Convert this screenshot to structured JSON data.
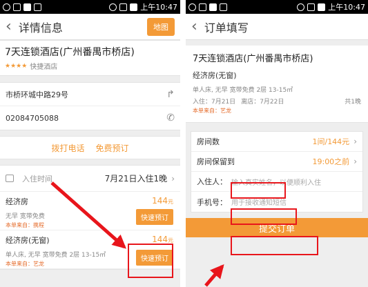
{
  "left": {
    "status": {
      "time": "上午10:47"
    },
    "nav": {
      "title": "详情信息",
      "map_label": "地图"
    },
    "hotel": {
      "name": "7天连锁酒店(广州番禺市桥店)",
      "category": "快捷酒店",
      "stars": "★★★★"
    },
    "address": "市桥环城中路29号",
    "phone": "02084705088",
    "actions": {
      "call": "拨打电话",
      "book_free": "免费预订"
    },
    "checkin": {
      "label": "入住时间",
      "value": "7月21日入住1晚"
    },
    "rooms": [
      {
        "name": "经济房",
        "price": "144",
        "unit": "元",
        "desc": "无早 宽带免费",
        "source": "本单来自：携程",
        "button": "快速预订"
      },
      {
        "name": "经济房(无窗)",
        "price": "144",
        "unit": "元",
        "desc": "单人床, 无早 宽带免费 2层 13-15㎡",
        "source": "本单来自：艺龙",
        "button": "快速预订"
      }
    ]
  },
  "right": {
    "status": {
      "time": "上午10:47"
    },
    "nav": {
      "title": "订单填写"
    },
    "order": {
      "hotel_name": "7天连锁酒店(广州番禺市桥店)",
      "room": "经济房(无窗)",
      "desc": "单人床, 无早 宽带免费 2层 13-15㎡",
      "checkin": "入住：7月21日",
      "checkout": "离店：7月22日",
      "nights": "共1晚",
      "source": "本单来自：艺龙"
    },
    "form": {
      "rooms_label": "房间数",
      "rooms_value": "1间/144元",
      "hold_label": "房间保留到",
      "hold_value": "19:00之前",
      "guest_label": "入住人：",
      "guest_placeholder": "输入真实姓名",
      "guest_hint": "，以便顺利入住",
      "mobile_label": "手机号：",
      "mobile_placeholder": "用于接收通知短信"
    },
    "submit_label": "提交订单"
  },
  "colors": {
    "accent": "#f39a37",
    "highlight": "#e8151b",
    "source": "#e56b2a"
  }
}
